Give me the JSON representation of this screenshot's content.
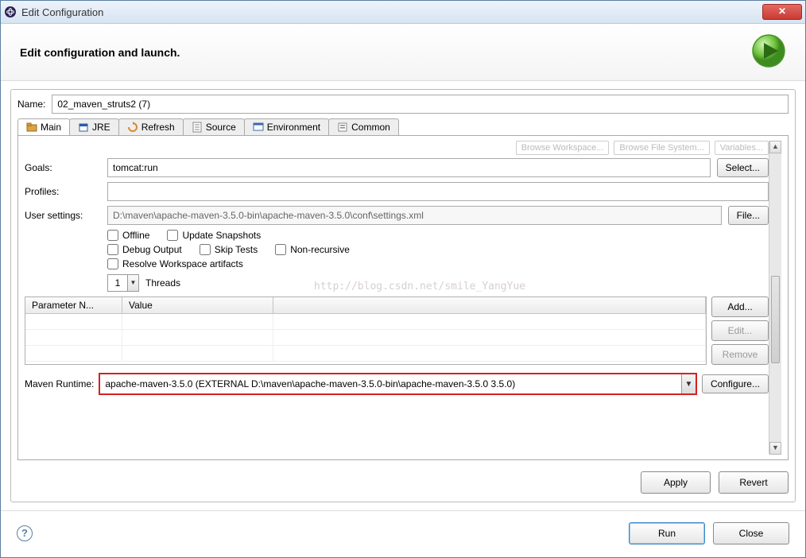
{
  "window": {
    "title": "Edit Configuration"
  },
  "banner": {
    "headline": "Edit configuration and launch."
  },
  "form": {
    "name_label": "Name:",
    "name_value": "02_maven_struts2 (7)"
  },
  "tabs": {
    "main": "Main",
    "jre": "JRE",
    "refresh": "Refresh",
    "source": "Source",
    "environment": "Environment",
    "common": "Common"
  },
  "ghost_buttons": {
    "browse_ws": "Browse Workspace...",
    "browse_fs": "Browse File System...",
    "variables": "Variables..."
  },
  "main_tab": {
    "goals_label": "Goals:",
    "goals_value": "tomcat:run",
    "select_btn": "Select...",
    "profiles_label": "Profiles:",
    "profiles_value": "",
    "user_settings_label": "User settings:",
    "user_settings_value": "D:\\maven\\apache-maven-3.5.0-bin\\apache-maven-3.5.0\\conf\\settings.xml",
    "file_btn": "File...",
    "checks": {
      "offline": "Offline",
      "update_snapshots": "Update Snapshots",
      "debug_output": "Debug Output",
      "skip_tests": "Skip Tests",
      "non_recursive": "Non-recursive",
      "resolve_workspace": "Resolve Workspace artifacts"
    },
    "threads_value": "1",
    "threads_label": "Threads",
    "param_table": {
      "col1": "Parameter N...",
      "col2": "Value"
    },
    "param_btns": {
      "add": "Add...",
      "edit": "Edit...",
      "remove": "Remove"
    },
    "runtime_label": "Maven Runtime:",
    "runtime_value": "apache-maven-3.5.0 (EXTERNAL D:\\maven\\apache-maven-3.5.0-bin\\apache-maven-3.5.0 3.5.0)",
    "configure_btn": "Configure..."
  },
  "buttons": {
    "apply": "Apply",
    "revert": "Revert",
    "run": "Run",
    "close": "Close"
  },
  "watermark": "http://blog.csdn.net/smile_YangYue"
}
